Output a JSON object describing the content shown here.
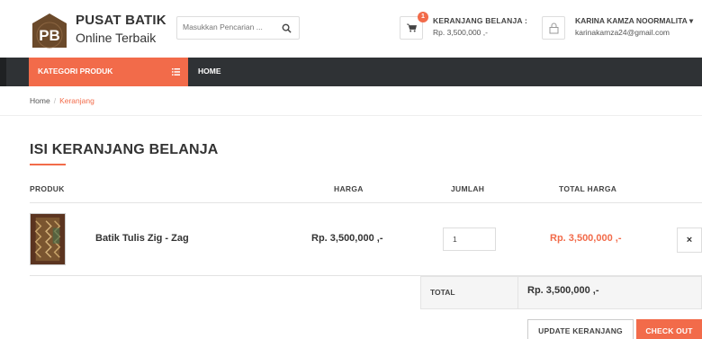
{
  "brand": {
    "logo_text": "PB",
    "name_line1": "PUSAT BATIK",
    "name_line2": "Online Terbaik"
  },
  "search": {
    "placeholder": "Masukkan Pencarian ..."
  },
  "cart": {
    "badge_count": "1",
    "title": "KERANJANG BELANJA :",
    "amount": "Rp. 3,500,000 ,-"
  },
  "user": {
    "name": "KARINA KAMZA NOORMALITA",
    "caret": "▾",
    "email": "karinakamza24@gmail.com"
  },
  "nav": {
    "category_label": "KATEGORI PRODUK",
    "home_label": "HOME"
  },
  "breadcrumb": {
    "home": "Home",
    "separator": "/",
    "current": "Keranjang"
  },
  "page_title": "ISI KERANJANG BELANJA",
  "table": {
    "headers": {
      "product": "PRODUK",
      "price": "HARGA",
      "qty": "JUMLAH",
      "total": "TOTAL HARGA"
    },
    "rows": [
      {
        "name": "Batik Tulis Zig - Zag",
        "price": "Rp. 3,500,000 ,-",
        "qty": "1",
        "total": "Rp. 3,500,000 ,-",
        "remove": "×"
      }
    ],
    "summary": {
      "label": "TOTAL",
      "value": "Rp. 3,500,000 ,-"
    }
  },
  "actions": {
    "update": "UPDATE KERANJANG",
    "checkout": "CHECK OUT"
  },
  "colors": {
    "accent": "#f26b4a",
    "nav_bg": "#2f3235",
    "logo_bg": "#6b4a2b"
  }
}
